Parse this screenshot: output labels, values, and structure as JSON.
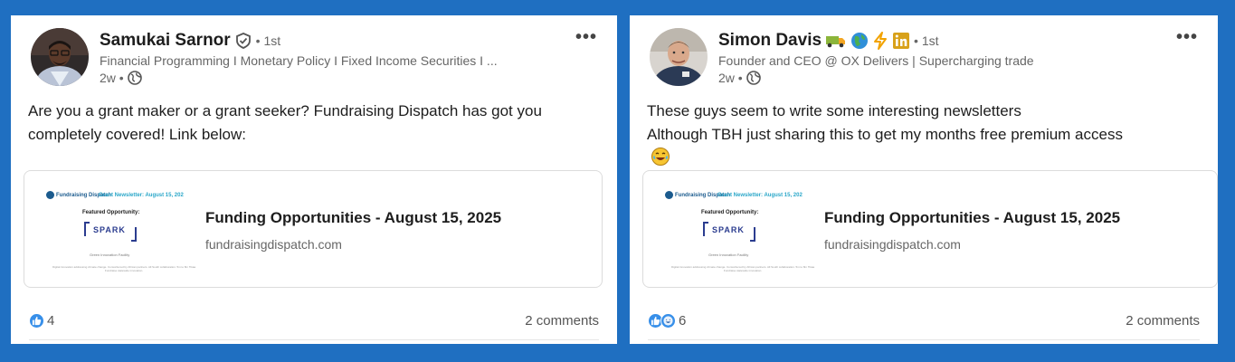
{
  "posts": [
    {
      "author": "Samukai Sarnor",
      "degree": "• 1st",
      "headline": "Financial Programming I Monetary Policy I Fixed Income Securities I ...",
      "time": "2w •",
      "text_lines": [
        "Are you a grant maker or a grant seeker? Fundraising Dispatch has got you",
        "completely covered! Link below:"
      ],
      "link": {
        "title": "Funding Opportunities - August 15, 2025",
        "domain": "fundraisingdispatch.com",
        "thumb_logo": "Fundraising Dispatch",
        "thumb_header": "Grant Newsletter: August 15, 202",
        "thumb_featured": "Featured Opportunity:",
        "thumb_spark": "SPARK",
        "thumb_sub": "Green Innovation Facility",
        "thumb_fine": "Digital innovation addressing climate change. Consortia led by African partners. All South collaboration. 5m to 8m Tikaa Fundraise statewide innovation."
      },
      "reaction_count": "4",
      "comments": "2 comments"
    },
    {
      "author": "Simon Davis",
      "degree": "• 1st",
      "headline": "Founder and CEO @ OX Delivers | Supercharging trade",
      "time": "2w •",
      "text_lines": [
        "These guys seem to write some interesting newsletters",
        "Although TBH just sharing this to get my months free premium access"
      ],
      "link": {
        "title": "Funding Opportunities - August 15, 2025",
        "domain": "fundraisingdispatch.com",
        "thumb_logo": "Fundraising Dispatch",
        "thumb_header": "Grant Newsletter: August 15, 202",
        "thumb_featured": "Featured Opportunity:",
        "thumb_spark": "SPARK",
        "thumb_sub": "Green Innovation Facility",
        "thumb_fine": "Digital innovation addressing climate change. Consortia led by African partners. All South collaboration. 5m to 8m Tikaa Fundraise statewide innovation."
      },
      "reaction_count": "6",
      "comments": "2 comments"
    }
  ],
  "icons": {
    "more": "more-options-icon",
    "globe": "globe-icon",
    "verified": "verified-badge-icon",
    "like": "like-reaction-icon",
    "funny": "funny-reaction-icon"
  },
  "colors": {
    "background": "#1f6fc1",
    "card": "#ffffff",
    "like_blue": "#378fe9",
    "linkedin_orange": "#d8a11a"
  }
}
